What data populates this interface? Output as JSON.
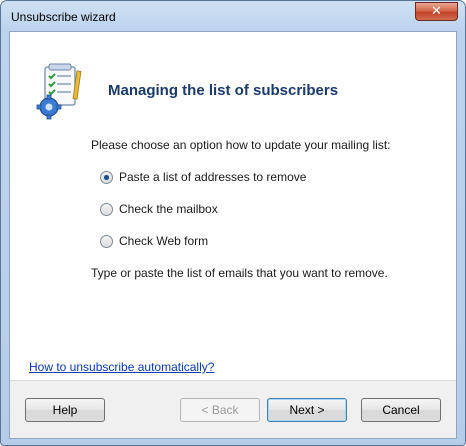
{
  "window": {
    "title": "Unsubscribe wizard",
    "close_glyph": "✕"
  },
  "header": {
    "title": "Managing the list of subscribers",
    "icon": "checklist-gear-icon"
  },
  "body": {
    "prompt": "Please choose an option how to update your mailing list:",
    "options": [
      {
        "label": "Paste a list of addresses to remove",
        "checked": true
      },
      {
        "label": "Check the mailbox",
        "checked": false
      },
      {
        "label": "Check Web form",
        "checked": false
      }
    ],
    "hint": "Type or paste the list of emails that you want to remove.",
    "help_link": "How to unsubscribe automatically?"
  },
  "footer": {
    "help": "Help",
    "back": "< Back",
    "next": "Next >",
    "cancel": "Cancel"
  }
}
